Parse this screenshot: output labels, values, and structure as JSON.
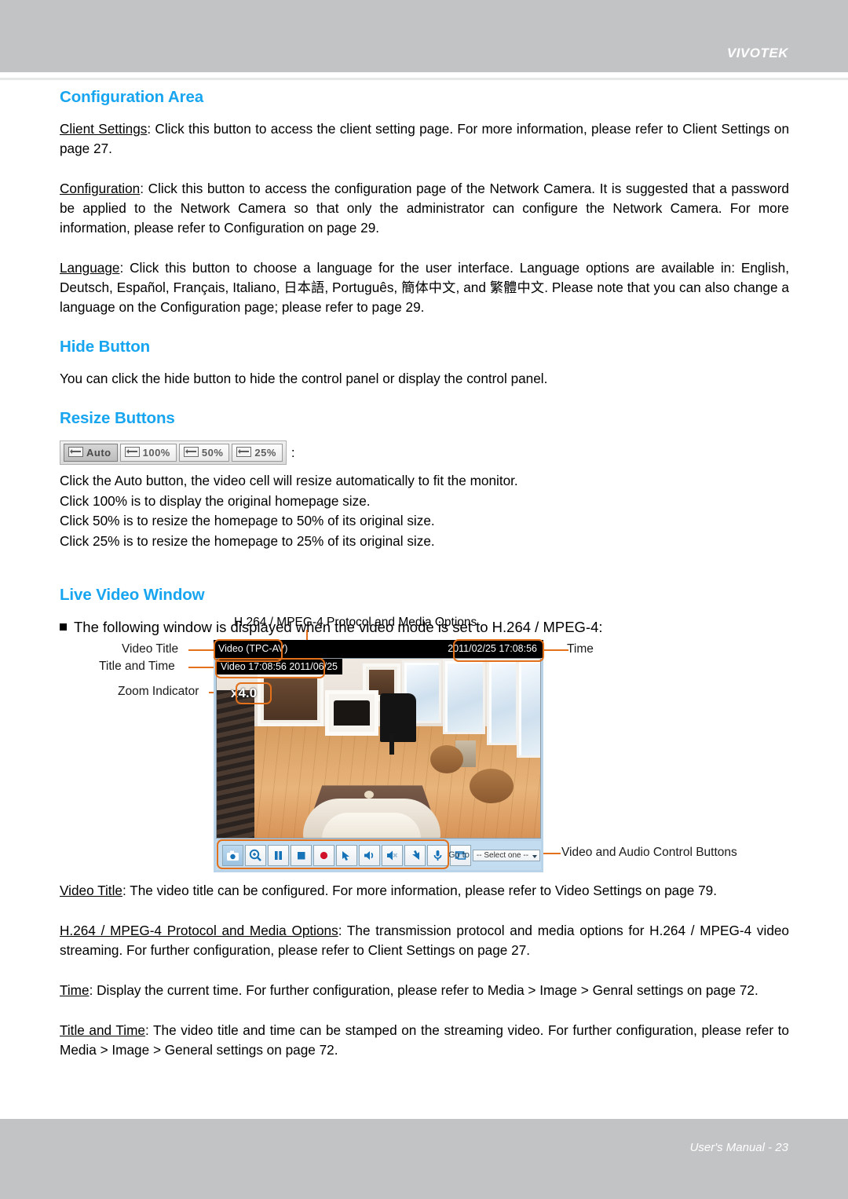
{
  "header": {
    "brand": "VIVOTEK"
  },
  "sections": {
    "configuration_area": {
      "heading": "Configuration Area",
      "paragraphs": [
        {
          "term": "Client Settings",
          "text": ": Click this button to access the client setting page. For more information, please refer to Client Settings on page 27."
        },
        {
          "term": "Configuration",
          "text": ": Click this button to access the configuration page of the Network Camera. It is suggested that a password be applied to the Network Camera so that only the administrator can configure the Network Camera. For more information, please refer to Configuration on page 29."
        },
        {
          "term": "Language",
          "text": ": Click this button to choose a language for the user interface. Language options are available in: English, Deutsch, Español, Français, Italiano, 日本語, Português, 簡体中文, and 繁體中文.  Please note that you can also change a language on the Configuration page; please refer to page 29."
        }
      ]
    },
    "hide_button": {
      "heading": "Hide Button",
      "text": "You can click the hide button to hide the control panel or display the control panel."
    },
    "resize_buttons": {
      "heading": "Resize Buttons",
      "buttons": [
        {
          "label": "Auto",
          "state": "pressed"
        },
        {
          "label": "100%",
          "state": "normal"
        },
        {
          "label": "50%",
          "state": "normal"
        },
        {
          "label": "25%",
          "state": "normal"
        }
      ],
      "colon": ":",
      "lines": [
        "Click the Auto button, the video cell will resize automatically to fit the monitor.",
        "Click 100% is to display the original homepage size.",
        "Click 50% is to resize the homepage to 50% of its original size.",
        "Click 25% is to resize the homepage to 25% of its original size."
      ]
    },
    "live_video_window": {
      "heading": "Live Video Window",
      "bullet": "The following window is displayed when the video mode is set to H.264 / MPEG-4:",
      "diagram": {
        "caption_top": "H.264 / MPEG-4 Protocol and Media Options",
        "labels": {
          "video_title": "Video Title",
          "title_and_time": "Title and Time",
          "zoom_indicator": "Zoom Indicator",
          "time": "Time",
          "controls": "Video and Audio Control Buttons"
        },
        "player": {
          "title_bar_text": "Video (TPC-AV)",
          "title_bar_time": "2011/02/25  17:08:56",
          "osd_title_time": "Video 17:08:56  2011/06/25",
          "zoom_level": "x4.0",
          "goto_label": "Go to",
          "goto_value": "-- Select one --",
          "buttons": [
            {
              "name": "snapshot-button",
              "icon": "camera-icon"
            },
            {
              "name": "digital-zoom-button",
              "icon": "magnifier-icon"
            },
            {
              "name": "pause-button",
              "icon": "pause-icon"
            },
            {
              "name": "stop-button",
              "icon": "stop-icon"
            },
            {
              "name": "record-button",
              "icon": "record-icon"
            },
            {
              "name": "save-video-button",
              "icon": "download-icon"
            },
            {
              "name": "volume-button",
              "icon": "speaker-icon"
            },
            {
              "name": "mute-button",
              "icon": "speaker-mute-icon"
            },
            {
              "name": "upload-button",
              "icon": "upload-icon"
            },
            {
              "name": "talk-button",
              "icon": "microphone-icon"
            },
            {
              "name": "fullscreen-button",
              "icon": "fullscreen-icon"
            }
          ]
        }
      }
    }
  },
  "glossary": [
    {
      "term": "Video Title",
      "text": ": The video title can be configured. For more information, please refer to Video Settings on page 79."
    },
    {
      "term": "H.264 / MPEG-4 Protocol and Media Options",
      "text": ": The transmission protocol and media options for H.264 / MPEG-4 video streaming. For further configuration, please refer to Client Settings on page 27."
    },
    {
      "term": "Time",
      "text": ": Display the current time. For further configuration, please refer to Media > Image > Genral settings on page 72."
    },
    {
      "term": "Title and Time",
      "text": ": The video title and time can be stamped on the streaming video. For further configuration, please refer to Media > Image > General settings on page 72."
    }
  ],
  "footer": {
    "text": "User's Manual - 23"
  },
  "colors": {
    "heading": "#18a5f0",
    "band": "#c2c3c4",
    "callout": "#e3701a"
  }
}
